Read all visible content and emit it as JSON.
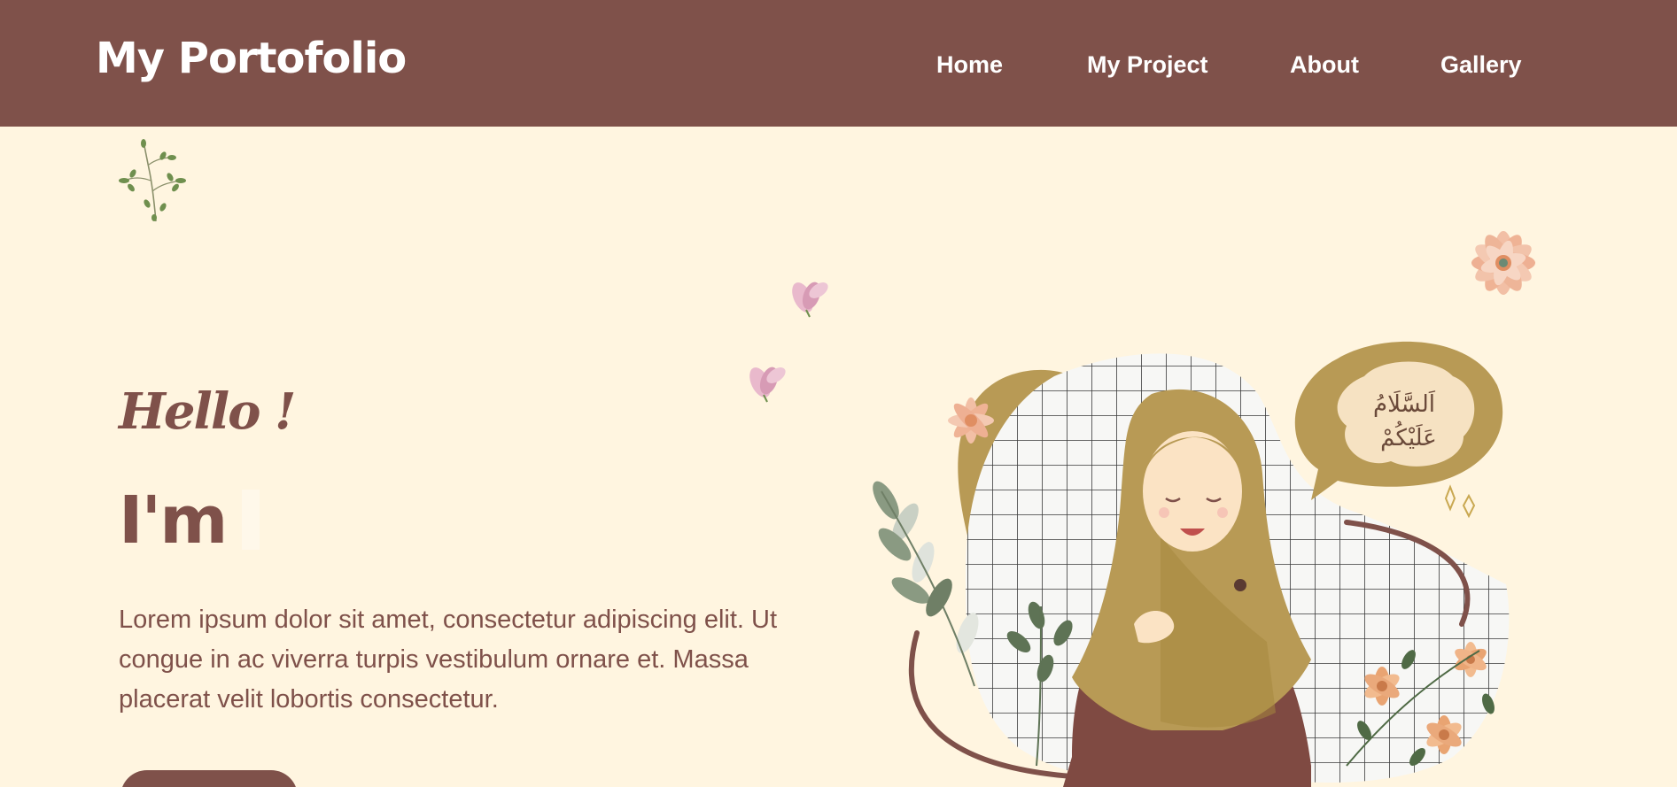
{
  "header": {
    "logo": "My Portofolio",
    "nav": [
      "Home",
      "My Project",
      "About",
      "Gallery"
    ]
  },
  "hero": {
    "greeting": "Hello !",
    "intro": "I'm",
    "description": "Lorem ipsum dolor sit amet, consectetur adipiscing elit. Ut congue in ac viverra turpis vestibulum ornare et. Massa placerat velit lobortis consectetur.",
    "speech_bubble": "اَلسَّلَامُ عَلَيْكُمْ"
  },
  "colors": {
    "primary": "#7f514a",
    "background": "#fff5e0",
    "mustard": "#b89a55"
  },
  "icons": [
    "leaf-sprig-icon",
    "peach-flower-icon",
    "pink-blossom-icon"
  ]
}
